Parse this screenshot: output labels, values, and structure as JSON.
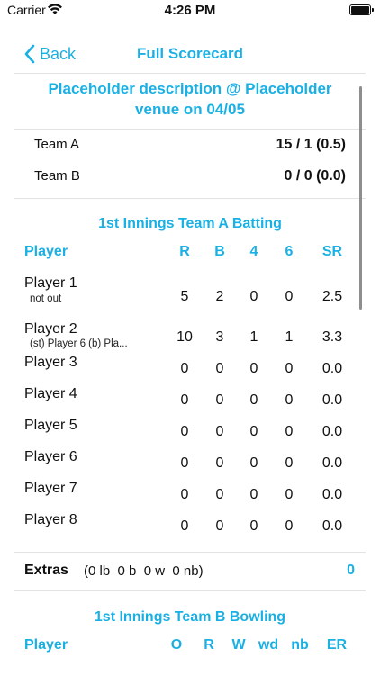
{
  "status": {
    "carrier": "Carrier",
    "time": "4:26 PM"
  },
  "nav": {
    "back_label": "Back",
    "title": "Full Scorecard"
  },
  "match": {
    "description": "Placeholder description @ Placeholder venue on 04/05"
  },
  "teams": [
    {
      "name": "Team A",
      "score": "15 / 1 (0.5)"
    },
    {
      "name": "Team B",
      "score": "0 / 0 (0.0)"
    }
  ],
  "batting": {
    "title": "1st Innings Team A Batting",
    "headers": {
      "player": "Player",
      "r": "R",
      "b": "B",
      "fours": "4",
      "sixes": "6",
      "sr": "SR"
    },
    "rows": [
      {
        "name": "Player 1",
        "dismissal": "not out",
        "r": "5",
        "b": "2",
        "fours": "0",
        "sixes": "0",
        "sr": "2.5"
      },
      {
        "name": "Player 2",
        "dismissal": "(st) Player 6 (b) Pla...",
        "r": "10",
        "b": "3",
        "fours": "1",
        "sixes": "1",
        "sr": "3.3"
      },
      {
        "name": "Player 3",
        "r": "0",
        "b": "0",
        "fours": "0",
        "sixes": "0",
        "sr": "0.0"
      },
      {
        "name": "Player 4",
        "r": "0",
        "b": "0",
        "fours": "0",
        "sixes": "0",
        "sr": "0.0"
      },
      {
        "name": "Player 5",
        "r": "0",
        "b": "0",
        "fours": "0",
        "sixes": "0",
        "sr": "0.0"
      },
      {
        "name": "Player 6",
        "r": "0",
        "b": "0",
        "fours": "0",
        "sixes": "0",
        "sr": "0.0"
      },
      {
        "name": "Player 7",
        "r": "0",
        "b": "0",
        "fours": "0",
        "sixes": "0",
        "sr": "0.0"
      },
      {
        "name": "Player 8",
        "r": "0",
        "b": "0",
        "fours": "0",
        "sixes": "0",
        "sr": "0.0"
      }
    ]
  },
  "extras": {
    "label": "Extras",
    "detail": "(0 lb  0 b  0 w  0 nb)",
    "total": "0"
  },
  "bowling": {
    "title": "1st Innings Team B Bowling",
    "headers": {
      "player": "Player",
      "o": "O",
      "r": "R",
      "w": "W",
      "wd": "wd",
      "nb": "nb",
      "er": "ER"
    }
  }
}
